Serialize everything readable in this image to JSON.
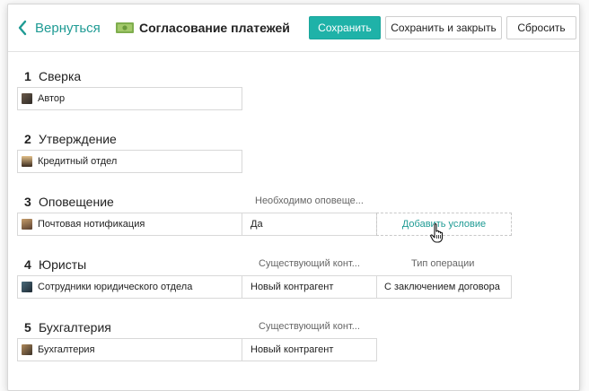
{
  "header": {
    "back_label": "Вернуться",
    "title": "Согласование платежей",
    "save_label": "Сохранить",
    "save_close_label": "Сохранить и закрыть",
    "reset_label": "Сбросить",
    "title_icon": "money-icon",
    "back_icon": "chevron-left-icon"
  },
  "colors": {
    "accent": "#1fb2a8",
    "link": "#1f9b94",
    "border": "#d8d8d8"
  },
  "sections": [
    {
      "num": "1",
      "name": "Сверка",
      "role": "Автор",
      "avatar_icon": "author-avatar"
    },
    {
      "num": "2",
      "name": "Утверждение",
      "role": "Кредитный отдел",
      "avatar_icon": "credit-dept-avatar"
    },
    {
      "num": "3",
      "name": "Оповещение",
      "role": "Почтовая нотификация",
      "avatar_icon": "mail-notification-avatar",
      "col1_label": "Необходимо оповеще...",
      "col1_value": "Да",
      "add_condition_label": "Добавить условие"
    },
    {
      "num": "4",
      "name": "Юристы",
      "role": "Сотрудники юридического отдела",
      "avatar_icon": "legal-dept-avatar",
      "col1_label": "Существующий конт...",
      "col1_value": "Новый контрагент",
      "col2_label": "Тип операции",
      "col2_value": "С заключением договора"
    },
    {
      "num": "5",
      "name": "Бухгалтерия",
      "role": "Бухгалтерия",
      "avatar_icon": "accounting-avatar",
      "col1_label": "Существующий конт...",
      "col1_value": "Новый контрагент"
    }
  ],
  "cursor_icon": "hand-pointer-icon"
}
